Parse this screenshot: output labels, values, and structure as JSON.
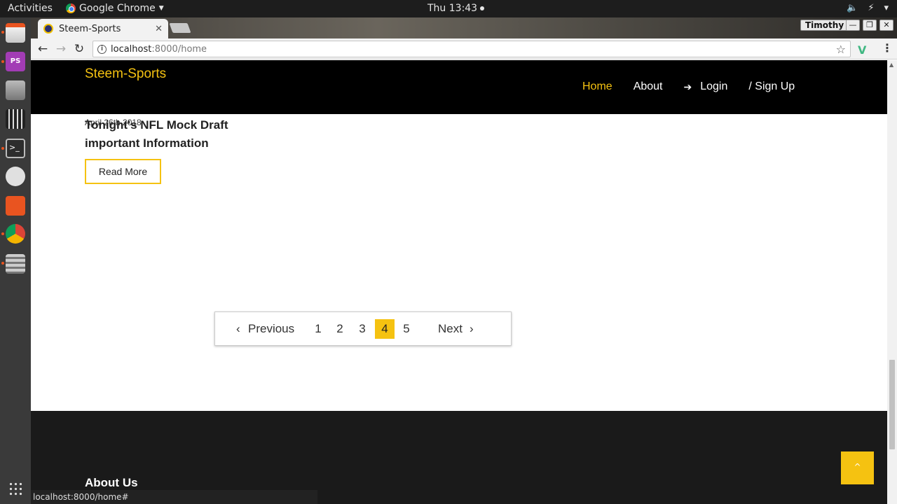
{
  "system": {
    "activities": "Activities",
    "app_name": "Google Chrome",
    "clock": "Thu 13:43"
  },
  "browser": {
    "tab_title": "Steem-Sports",
    "profile": "Timothy",
    "url_host": "localhost",
    "url_rest": ":8000/home",
    "status_url": "localhost:8000/home#"
  },
  "site": {
    "brand": "Steem-Sports",
    "nav": {
      "home": "Home",
      "about": "About",
      "login": "Login",
      "signup": "/ Sign Up"
    },
    "accent": "#f5c211"
  },
  "article": {
    "date": "April 26th 2018",
    "title": "Tonight's NFL Mock Draft important Information",
    "read_more": "Read More"
  },
  "pagination": {
    "previous": "Previous",
    "pages": [
      "1",
      "2",
      "3",
      "4",
      "5"
    ],
    "current": "4",
    "next": "Next"
  },
  "footer": {
    "title": "About Us"
  },
  "icons": {
    "back_to_top": "chevron-up-icon",
    "login": "sign-in-icon"
  }
}
